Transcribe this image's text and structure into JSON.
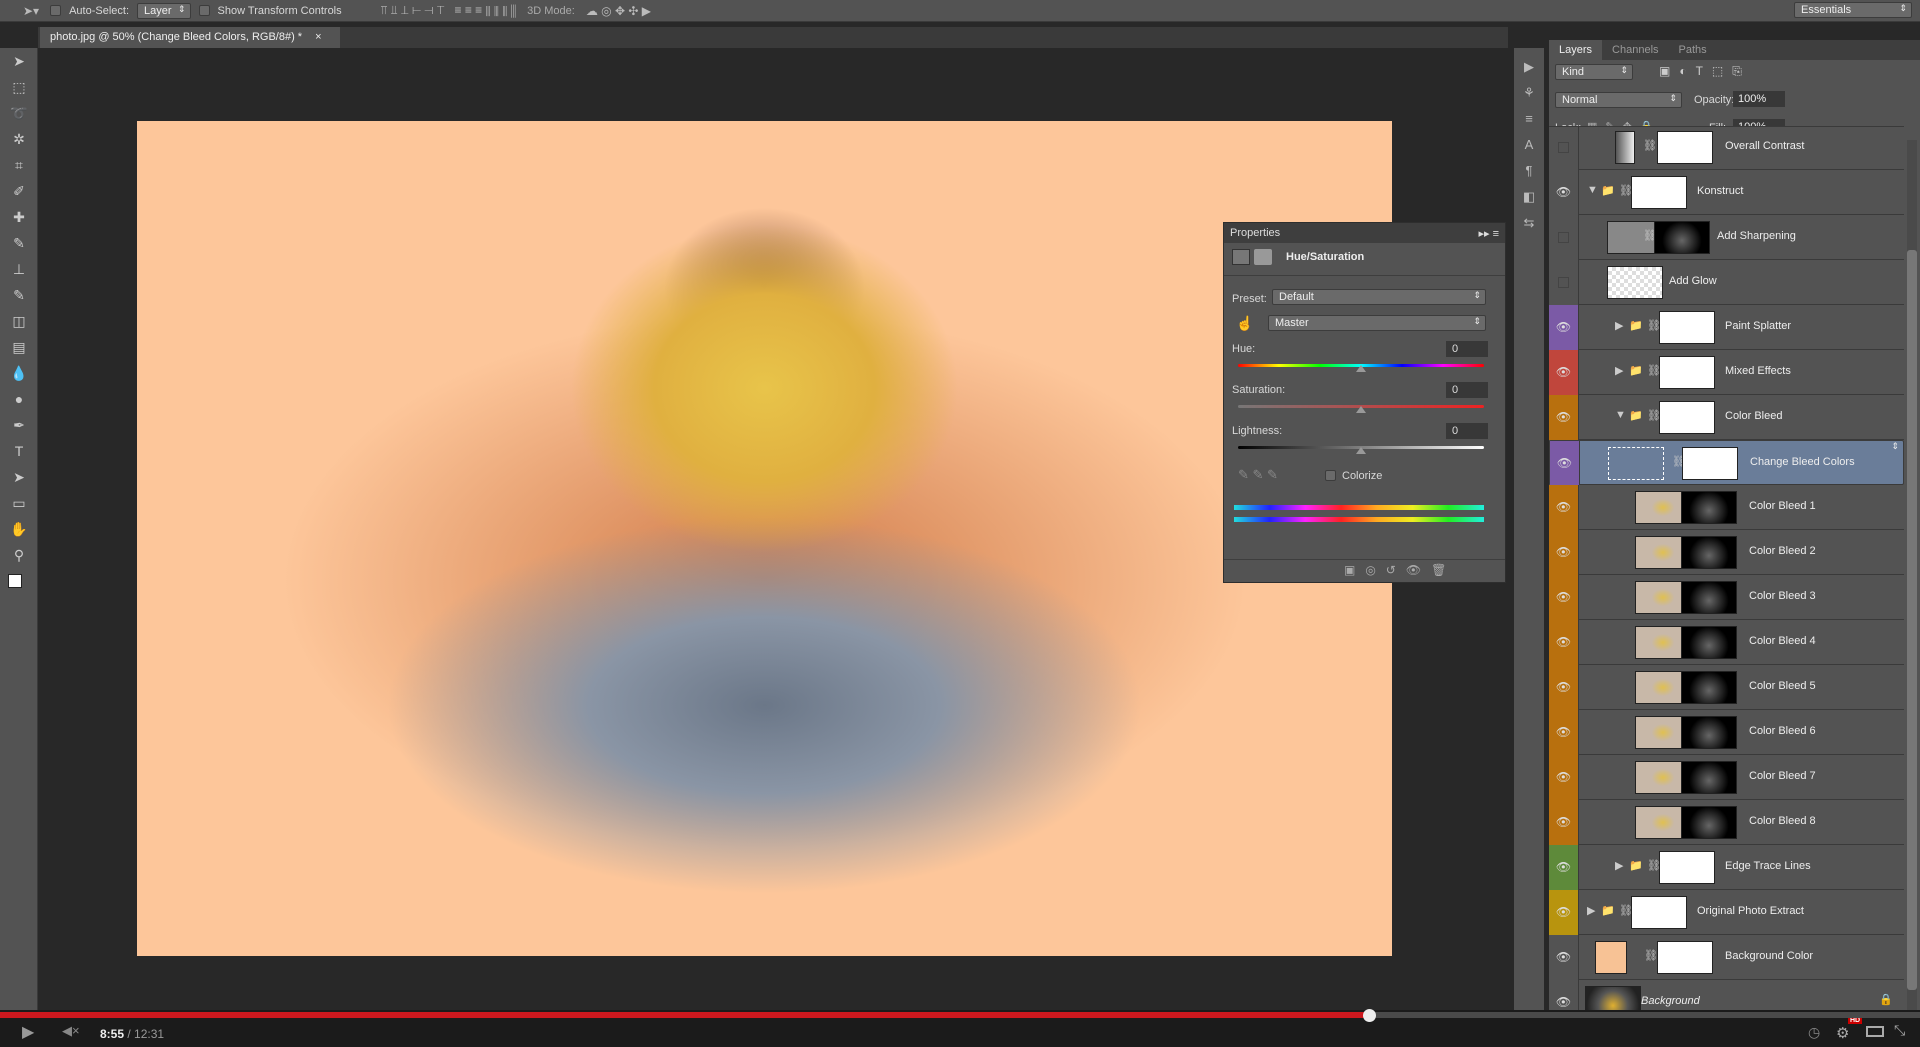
{
  "options_bar": {
    "auto_select_label": "Auto-Select:",
    "auto_select_value": "Layer",
    "transform_label": "Show Transform Controls",
    "mode_label": "3D Mode:",
    "workspace": "Essentials"
  },
  "document_tab": {
    "title": "photo.jpg @ 50% (Change Bleed Colors, RGB/8#) *",
    "close": "×"
  },
  "tools": [
    "move",
    "marquee",
    "lasso",
    "magic-wand",
    "crop",
    "eyedropper",
    "healing",
    "brush",
    "stamp",
    "history-brush",
    "eraser",
    "gradient",
    "blur",
    "dodge",
    "pen",
    "type",
    "path-select",
    "shape",
    "hand",
    "zoom"
  ],
  "properties": {
    "tab": "Properties",
    "title": "Hue/Saturation",
    "preset_label": "Preset:",
    "preset_value": "Default",
    "channel_value": "Master",
    "hue_label": "Hue:",
    "hue_value": "0",
    "saturation_label": "Saturation:",
    "saturation_value": "0",
    "lightness_label": "Lightness:",
    "lightness_value": "0",
    "colorize_label": "Colorize",
    "colorize_checked": false
  },
  "layers_panel": {
    "tabs": [
      "Layers",
      "Channels",
      "Paths"
    ],
    "filter_value": "Kind",
    "blend_mode": "Normal",
    "opacity_label": "Opacity:",
    "opacity_value": "100%",
    "lock_label": "Lock:",
    "fill_label": "Fill:",
    "fill_value": "100%",
    "layers": [
      {
        "name": "Overall Contrast",
        "visible": false,
        "label_color": "",
        "kind": "adjustment"
      },
      {
        "name": "Konstruct",
        "visible": true,
        "label_color": "",
        "kind": "group-open"
      },
      {
        "name": "Add Sharpening",
        "visible": false,
        "label_color": "",
        "kind": "masked"
      },
      {
        "name": "Add Glow",
        "visible": false,
        "label_color": "",
        "kind": "pixel"
      },
      {
        "name": "Paint Splatter",
        "visible": true,
        "label_color": "#7b5aa6",
        "kind": "group"
      },
      {
        "name": "Mixed Effects",
        "visible": true,
        "label_color": "#c0463c",
        "kind": "group"
      },
      {
        "name": "Color Bleed",
        "visible": true,
        "label_color": "#b8700e",
        "kind": "group-open"
      },
      {
        "name": "Change Bleed Colors",
        "visible": true,
        "label_color": "#7b5aa6",
        "kind": "adjustment",
        "selected": true
      },
      {
        "name": "Color Bleed 1",
        "visible": true,
        "label_color": "#b8700e",
        "kind": "photo"
      },
      {
        "name": "Color Bleed 2",
        "visible": true,
        "label_color": "#b8700e",
        "kind": "photo"
      },
      {
        "name": "Color Bleed 3",
        "visible": true,
        "label_color": "#b8700e",
        "kind": "photo"
      },
      {
        "name": "Color Bleed 4",
        "visible": true,
        "label_color": "#b8700e",
        "kind": "photo"
      },
      {
        "name": "Color Bleed 5",
        "visible": true,
        "label_color": "#b8700e",
        "kind": "photo"
      },
      {
        "name": "Color Bleed 6",
        "visible": true,
        "label_color": "#b8700e",
        "kind": "photo"
      },
      {
        "name": "Color Bleed 7",
        "visible": true,
        "label_color": "#b8700e",
        "kind": "photo"
      },
      {
        "name": "Color Bleed 8",
        "visible": true,
        "label_color": "#b8700e",
        "kind": "photo"
      },
      {
        "name": "Edge Trace Lines",
        "visible": true,
        "label_color": "#5e8a3a",
        "kind": "group"
      },
      {
        "name": "Original Photo Extract",
        "visible": true,
        "label_color": "#b8940e",
        "kind": "group-top"
      },
      {
        "name": "Background Color",
        "visible": true,
        "label_color": "",
        "kind": "fill"
      },
      {
        "name": "Background",
        "visible": true,
        "label_color": "",
        "kind": "background"
      }
    ]
  },
  "video": {
    "current": "8:55",
    "duration": "/ 12:31",
    "progress": 0.713,
    "hd": "HD"
  }
}
